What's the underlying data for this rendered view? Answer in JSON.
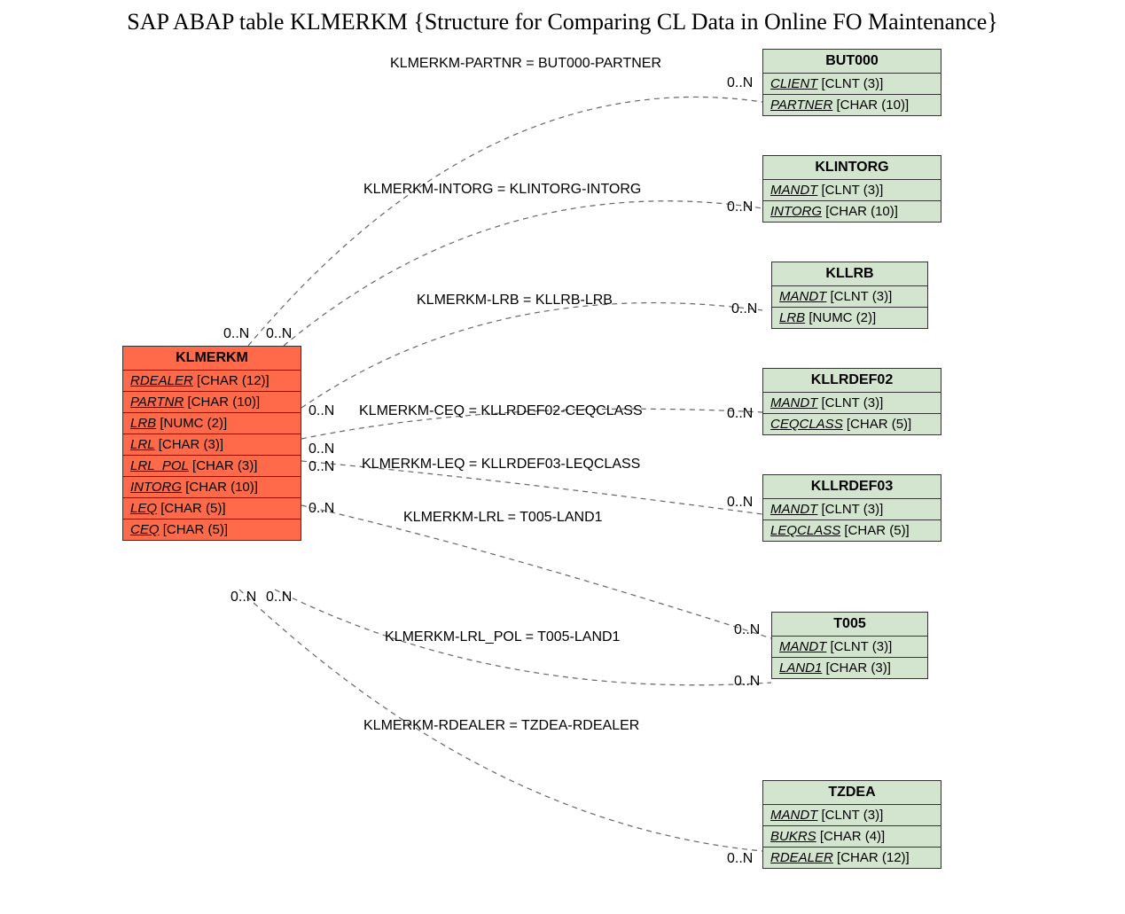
{
  "title": "SAP ABAP table KLMERKM {Structure for Comparing CL Data in Online FO Maintenance}",
  "main": {
    "name": "KLMERKM",
    "fields": [
      {
        "n": "RDEALER",
        "t": "[CHAR (12)]"
      },
      {
        "n": "PARTNR",
        "t": "[CHAR (10)]"
      },
      {
        "n": "LRB",
        "t": "[NUMC (2)]"
      },
      {
        "n": "LRL",
        "t": "[CHAR (3)]"
      },
      {
        "n": "LRL_POL",
        "t": "[CHAR (3)]"
      },
      {
        "n": "INTORG",
        "t": "[CHAR (10)]"
      },
      {
        "n": "LEQ",
        "t": "[CHAR (5)]"
      },
      {
        "n": "CEQ",
        "t": "[CHAR (5)]"
      }
    ]
  },
  "targets": [
    {
      "name": "BUT000",
      "fields": [
        {
          "n": "CLIENT",
          "t": "[CLNT (3)]"
        },
        {
          "n": "PARTNER",
          "t": "[CHAR (10)]"
        }
      ]
    },
    {
      "name": "KLINTORG",
      "fields": [
        {
          "n": "MANDT",
          "t": "[CLNT (3)]"
        },
        {
          "n": "INTORG",
          "t": "[CHAR (10)]"
        }
      ]
    },
    {
      "name": "KLLRB",
      "fields": [
        {
          "n": "MANDT",
          "t": "[CLNT (3)]"
        },
        {
          "n": "LRB",
          "t": "[NUMC (2)]"
        }
      ]
    },
    {
      "name": "KLLRDEF02",
      "fields": [
        {
          "n": "MANDT",
          "t": "[CLNT (3)]"
        },
        {
          "n": "CEQCLASS",
          "t": "[CHAR (5)]"
        }
      ]
    },
    {
      "name": "KLLRDEF03",
      "fields": [
        {
          "n": "MANDT",
          "t": "[CLNT (3)]"
        },
        {
          "n": "LEQCLASS",
          "t": "[CHAR (5)]"
        }
      ]
    },
    {
      "name": "T005",
      "fields": [
        {
          "n": "MANDT",
          "t": "[CLNT (3)]"
        },
        {
          "n": "LAND1",
          "t": "[CHAR (3)]"
        }
      ]
    },
    {
      "name": "TZDEA",
      "fields": [
        {
          "n": "MANDT",
          "t": "[CLNT (3)]"
        },
        {
          "n": "BUKRS",
          "t": "[CHAR (4)]"
        },
        {
          "n": "RDEALER",
          "t": "[CHAR (12)]"
        }
      ]
    }
  ],
  "relations": [
    {
      "text": "KLMERKM-PARTNR = BUT000-PARTNER"
    },
    {
      "text": "KLMERKM-INTORG = KLINTORG-INTORG"
    },
    {
      "text": "KLMERKM-LRB = KLLRB-LRB"
    },
    {
      "text": "KLMERKM-CEQ = KLLRDEF02-CEQCLASS"
    },
    {
      "text": "KLMERKM-LEQ = KLLRDEF03-LEQCLASS"
    },
    {
      "text": "KLMERKM-LRL = T005-LAND1"
    },
    {
      "text": "KLMERKM-LRL_POL = T005-LAND1"
    },
    {
      "text": "KLMERKM-RDEALER = TZDEA-RDEALER"
    }
  ],
  "card": {
    "src_nn": "0..N",
    "tgt_nn": "0..N"
  }
}
